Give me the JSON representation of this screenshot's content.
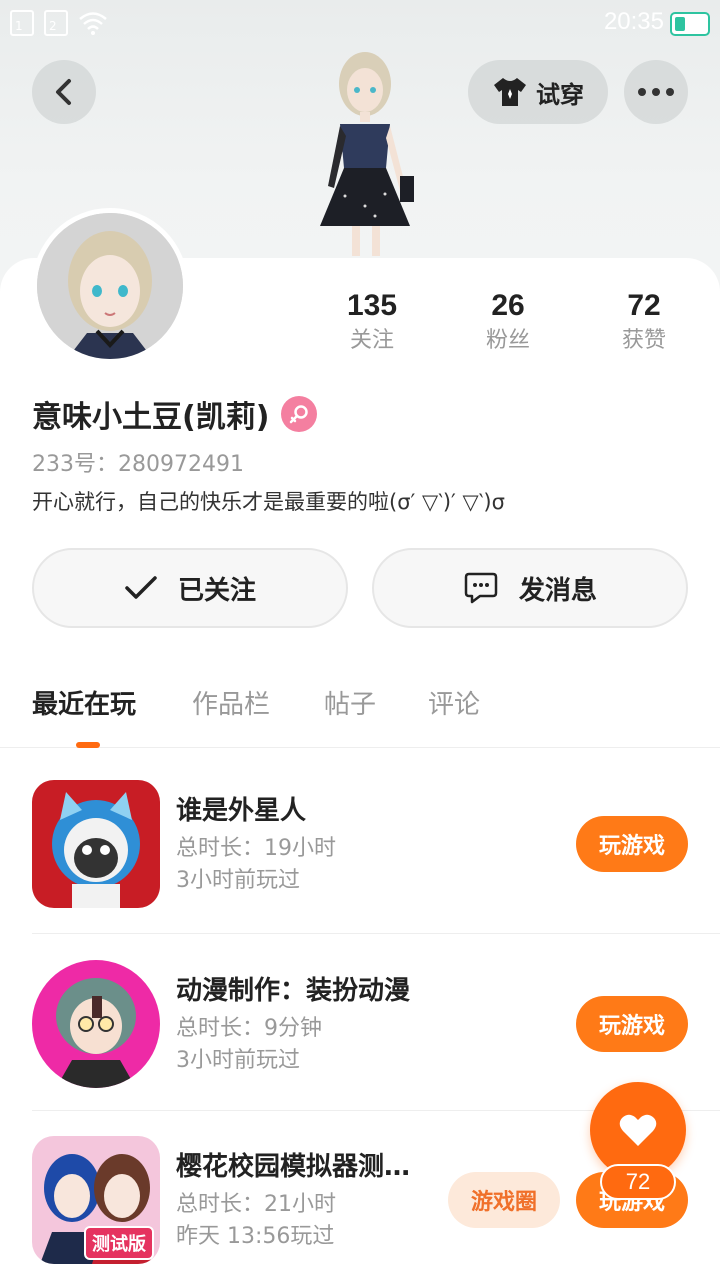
{
  "status_bar": {
    "sim1": "1",
    "sim2": "2",
    "time": "20:35"
  },
  "header": {
    "try_on_label": "试穿"
  },
  "profile": {
    "name": "意味小土豆(凯莉)",
    "uid": "233号：280972491",
    "bio": "开心就行，自己的快乐才是最重要的啦(σ′ ▽‵)′ ▽‵)σ",
    "gender_icon": "female-icon",
    "stats": [
      {
        "value": "135",
        "label": "关注"
      },
      {
        "value": "26",
        "label": "粉丝"
      },
      {
        "value": "72",
        "label": "获赞"
      }
    ]
  },
  "actions": {
    "follow_label": "已关注",
    "message_label": "发消息"
  },
  "tabs": [
    {
      "label": "最近在玩",
      "active": true
    },
    {
      "label": "作品栏",
      "active": false
    },
    {
      "label": "帖子",
      "active": false
    },
    {
      "label": "评论",
      "active": false
    }
  ],
  "games": [
    {
      "title": "谁是外星人",
      "duration": "总时长：19小时",
      "last_played": "3小时前玩过",
      "play_label": "玩游戏"
    },
    {
      "title": "动漫制作：装扮动漫",
      "duration": "总时长：9分钟",
      "last_played": "3小时前玩过",
      "play_label": "玩游戏"
    },
    {
      "title": "樱花校园模拟器测…",
      "duration": "总时长：21小时",
      "last_played": "昨天 13:56玩过",
      "play_label": "玩游戏",
      "circle_label": "游戏圈",
      "icon_badge": "测试版"
    }
  ],
  "fab": {
    "like_count": "72"
  },
  "colors": {
    "accent": "#ff6a10",
    "play_button": "#ff7a17",
    "gender": "#f47fa0",
    "battery": "#2ec4a0"
  }
}
